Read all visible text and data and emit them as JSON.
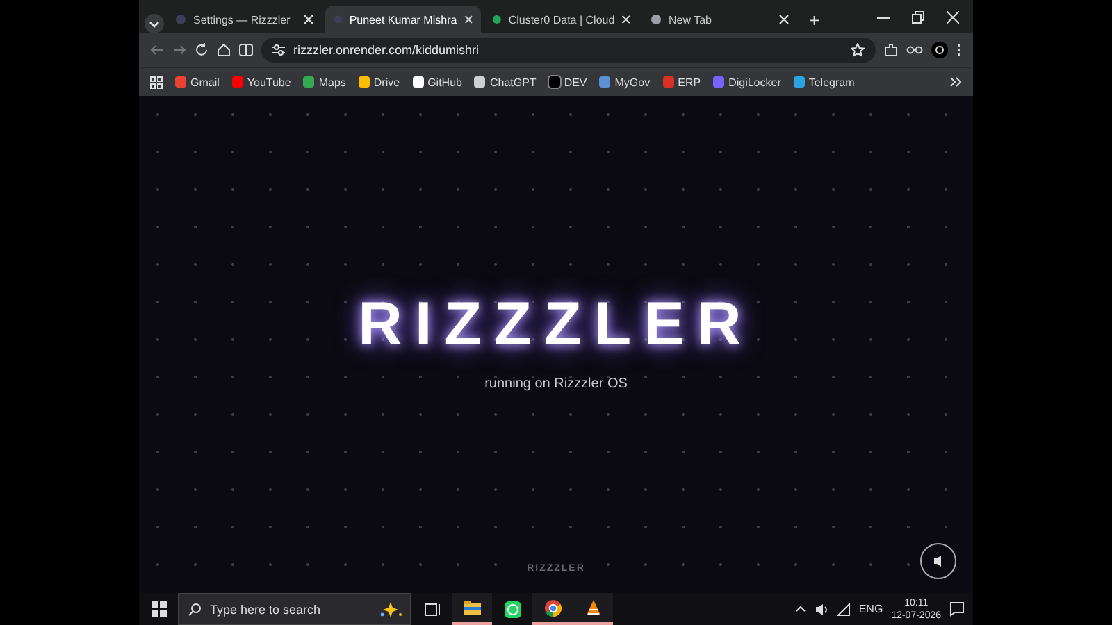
{
  "tabs": [
    {
      "title": "Settings — Rizzzler",
      "selected": false
    },
    {
      "title": "Puneet Kumar Mishra",
      "selected": true
    },
    {
      "title": "Cluster0 Data | Cloud",
      "selected": false
    },
    {
      "title": "New Tab",
      "selected": false
    }
  ],
  "new_tab": "+",
  "address": "rizzzler.onrender.com/kiddumishri",
  "bookmarks": [
    {
      "label": "Gmail",
      "color": "#ea4335"
    },
    {
      "label": "YouTube",
      "color": "#ff0000"
    },
    {
      "label": "Maps",
      "color": "#34a853"
    },
    {
      "label": "Drive",
      "color": "#fbbc04"
    },
    {
      "label": "GitHub",
      "color": "#ffffff"
    },
    {
      "label": "ChatGPT",
      "color": "#d0d0d0"
    },
    {
      "label": "DEV",
      "color": "#000000"
    },
    {
      "label": "MyGov",
      "color": "#5c8fd6"
    },
    {
      "label": "ERP",
      "color": "#d93025"
    },
    {
      "label": "DigiLocker",
      "color": "#7b61ff"
    },
    {
      "label": "Telegram",
      "color": "#2aa3e0"
    }
  ],
  "page": {
    "title": "RIZZZLER",
    "subtitle": "running on Rizzzler OS",
    "footer": "RIZZZLER"
  },
  "taskbar": {
    "search": {
      "placeholder": "Type here to search"
    },
    "apps": [
      {
        "kind": "files",
        "open": true
      },
      {
        "kind": "whatsapp",
        "open": false
      },
      {
        "kind": "chrome",
        "open": true
      },
      {
        "kind": "vlc",
        "open": true
      }
    ],
    "language": "ENG",
    "time": "10:11",
    "date": "12-07-2026"
  }
}
